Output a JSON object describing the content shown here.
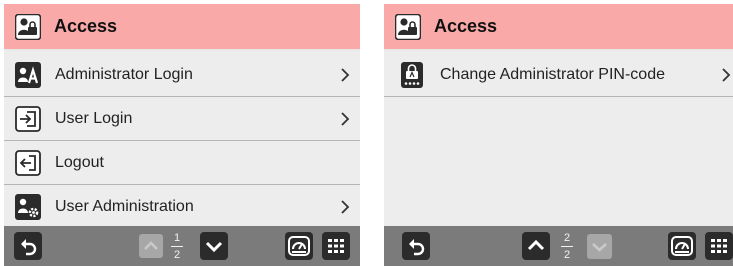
{
  "colors": {
    "header_bg": "#f8a9a8",
    "item_bg": "#ededed",
    "footer_bg": "#7b7b7b",
    "icon_dark": "#2b2b2b",
    "disabled_button": "#a7a7a7"
  },
  "screens": [
    {
      "header": {
        "title": "Access",
        "icon": "user-lock-icon"
      },
      "items": [
        {
          "label": "Administrator Login",
          "icon": "admin-login-icon",
          "chevron": true
        },
        {
          "label": "User Login",
          "icon": "login-icon",
          "chevron": true
        },
        {
          "label": "Logout",
          "icon": "logout-icon",
          "chevron": false
        },
        {
          "label": "User Administration",
          "icon": "user-admin-icon",
          "chevron": true
        }
      ],
      "footer": {
        "page_current": "1",
        "page_total": "2",
        "prev_enabled": false,
        "next_enabled": true
      }
    },
    {
      "header": {
        "title": "Access",
        "icon": "user-lock-icon"
      },
      "items": [
        {
          "label": "Change Administrator PIN-code",
          "icon": "pin-code-icon",
          "chevron": true
        }
      ],
      "footer": {
        "page_current": "2",
        "page_total": "2",
        "prev_enabled": true,
        "next_enabled": false
      }
    }
  ]
}
